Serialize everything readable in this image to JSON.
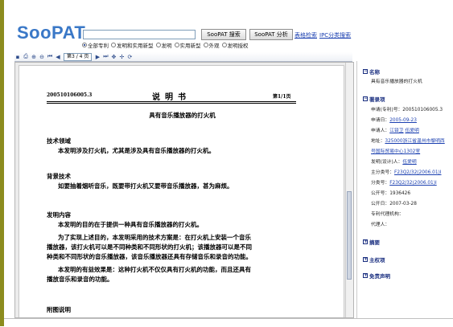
{
  "header": {
    "logo": "SooPAT",
    "search_value": "",
    "btn_search": "SooPAT 搜索",
    "btn_analyze": "SooPAT 分析",
    "link_table_search": "表格检索",
    "link_ipc": "IPC分类搜索",
    "radios": [
      {
        "label": "全部专利",
        "checked": true
      },
      {
        "label": "发明和实用新型",
        "checked": false
      },
      {
        "label": "发明",
        "checked": false
      },
      {
        "label": "实用新型",
        "checked": false
      },
      {
        "label": "外观",
        "checked": false
      },
      {
        "label": "发明授权",
        "checked": false
      }
    ]
  },
  "toolbar": {
    "page_indicator": "第3 / 4 页"
  },
  "document": {
    "number": "200510106005.3",
    "title": "说明书",
    "page_no": "第1/1页",
    "invention_title": "具有音乐播放器的打火机",
    "sections": [
      {
        "head": "技术领域",
        "text": "本发明涉及打火机，尤其是涉及具有音乐播放器的打火机。"
      },
      {
        "head": "背景技术",
        "text": "如要抽着烟听音乐，既要带打火机又要带音乐播放器，甚为麻烦。"
      },
      {
        "head": "发明内容",
        "text": "本发明的目的在于提供一种具有音乐播放器的打火机。"
      }
    ],
    "para_tech_1": "为了实现上述目的，本发明采用的技术方案是：在打火机上安装一个音乐",
    "para_tech_2": "播放器，该打火机可以是不同种类和不同形状的打火机；该播放器可以是不同",
    "para_tech_3": "种类和不同形状的音乐播放器，该音乐播放器还具有存储音乐和录音的功能。",
    "para_benefit_1": "本发明的有益效果是：这种打火机不仅仅具有打火机的功能，而且还具有",
    "para_benefit_2": "播放音乐和录音的功能。",
    "section_drawings": "附图说明"
  },
  "right_panel": {
    "name_head": "名称",
    "name_value": "具有音乐播放器的打火机",
    "biblio_head": "著录项",
    "app_no": "申请(专利)号：200510106005.3",
    "app_date_label": "申请日：",
    "app_date": "2005-09-23",
    "applicant_label": "申请人：",
    "applicant_1": "江铎卫",
    "applicant_2": "伍爱明",
    "address_label": "地址：",
    "address_1": "325000浙江省温州市黎明西",
    "address_2": "号国际贸易中心1302室",
    "inventor_label": "发明(设计)人：",
    "inventor": "伍爱明",
    "main_class_label": "主分类号：",
    "main_class": "F23Q2/32(2006.01)I",
    "class_label": "分类号：",
    "class_value": "F23Q2/32(2006.01)I",
    "pub_no": "公开号：1936426",
    "pub_date": "公开日：2007-03-28",
    "agency": "专利代理机构：",
    "agent": "代理人：",
    "abstract_head": "摘要",
    "claims_head": "主权项",
    "disclaimer_head": "免责声明"
  }
}
